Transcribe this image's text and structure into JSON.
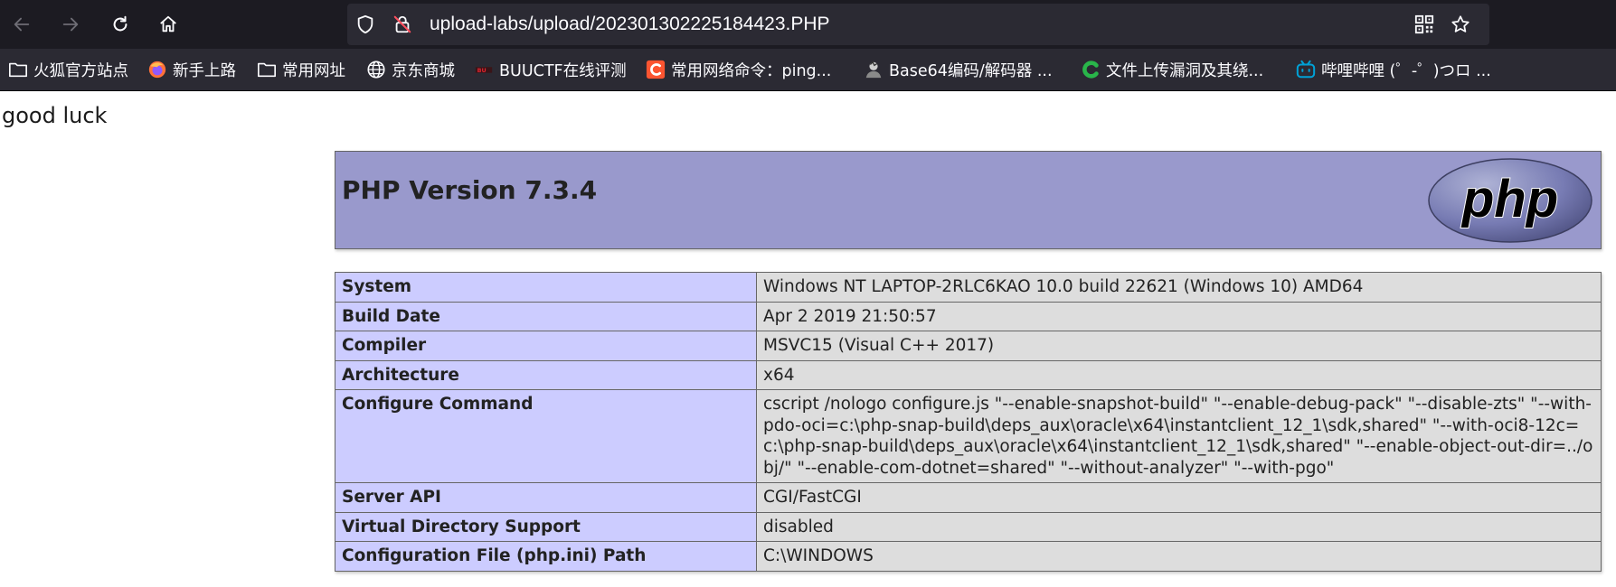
{
  "browser": {
    "url": "upload-labs/upload/202301302225184423.PHP",
    "bookmarks": [
      {
        "label": "火狐官方站点",
        "icon": "folder-icon"
      },
      {
        "label": "新手上路",
        "icon": "firefox-icon"
      },
      {
        "label": "常用网址",
        "icon": "folder-icon"
      },
      {
        "label": "京东商城",
        "icon": "globe-icon"
      },
      {
        "label": "BUUCTF在线评测",
        "icon": "buuctf-icon"
      },
      {
        "label": "常用网络命令：ping...",
        "icon": "csdn-icon"
      },
      {
        "label": "Base64编码/解码器 ...",
        "icon": "avatar-icon"
      },
      {
        "label": "文件上传漏洞及其绕...",
        "icon": "c-green-icon"
      },
      {
        "label": "哔哩哔哩 (゜-゜)つロ ...",
        "icon": "bilibili-icon"
      }
    ]
  },
  "page": {
    "greeting": "good luck",
    "php_title": "PHP Version 7.3.4",
    "logo_text": "php",
    "rows": [
      {
        "key": "System",
        "value": "Windows NT LAPTOP-2RLC6KAO 10.0 build 22621 (Windows 10) AMD64"
      },
      {
        "key": "Build Date",
        "value": "Apr 2 2019 21:50:57"
      },
      {
        "key": "Compiler",
        "value": "MSVC15 (Visual C++ 2017)"
      },
      {
        "key": "Architecture",
        "value": "x64"
      },
      {
        "key": "Configure Command",
        "value": "cscript /nologo configure.js \"--enable-snapshot-build\" \"--enable-debug-pack\" \"--disable-zts\" \"--with-pdo-oci=c:\\php-snap-build\\deps_aux\\oracle\\x64\\instantclient_12_1\\sdk,shared\" \"--with-oci8-12c=c:\\php-snap-build\\deps_aux\\oracle\\x64\\instantclient_12_1\\sdk,shared\" \"--enable-object-out-dir=../obj/\" \"--enable-com-dotnet=shared\" \"--without-analyzer\" \"--with-pgo\""
      },
      {
        "key": "Server API",
        "value": "CGI/FastCGI"
      },
      {
        "key": "Virtual Directory Support",
        "value": "disabled"
      },
      {
        "key": "Configuration File (php.ini) Path",
        "value": "C:\\WINDOWS"
      }
    ]
  },
  "colors": {
    "toolbar_bg": "#1c1b22",
    "urlbar_bg": "#2b2a33",
    "php_header_bg": "#9999cc",
    "key_cell_bg": "#ccccff",
    "value_cell_bg": "#dddddd"
  }
}
